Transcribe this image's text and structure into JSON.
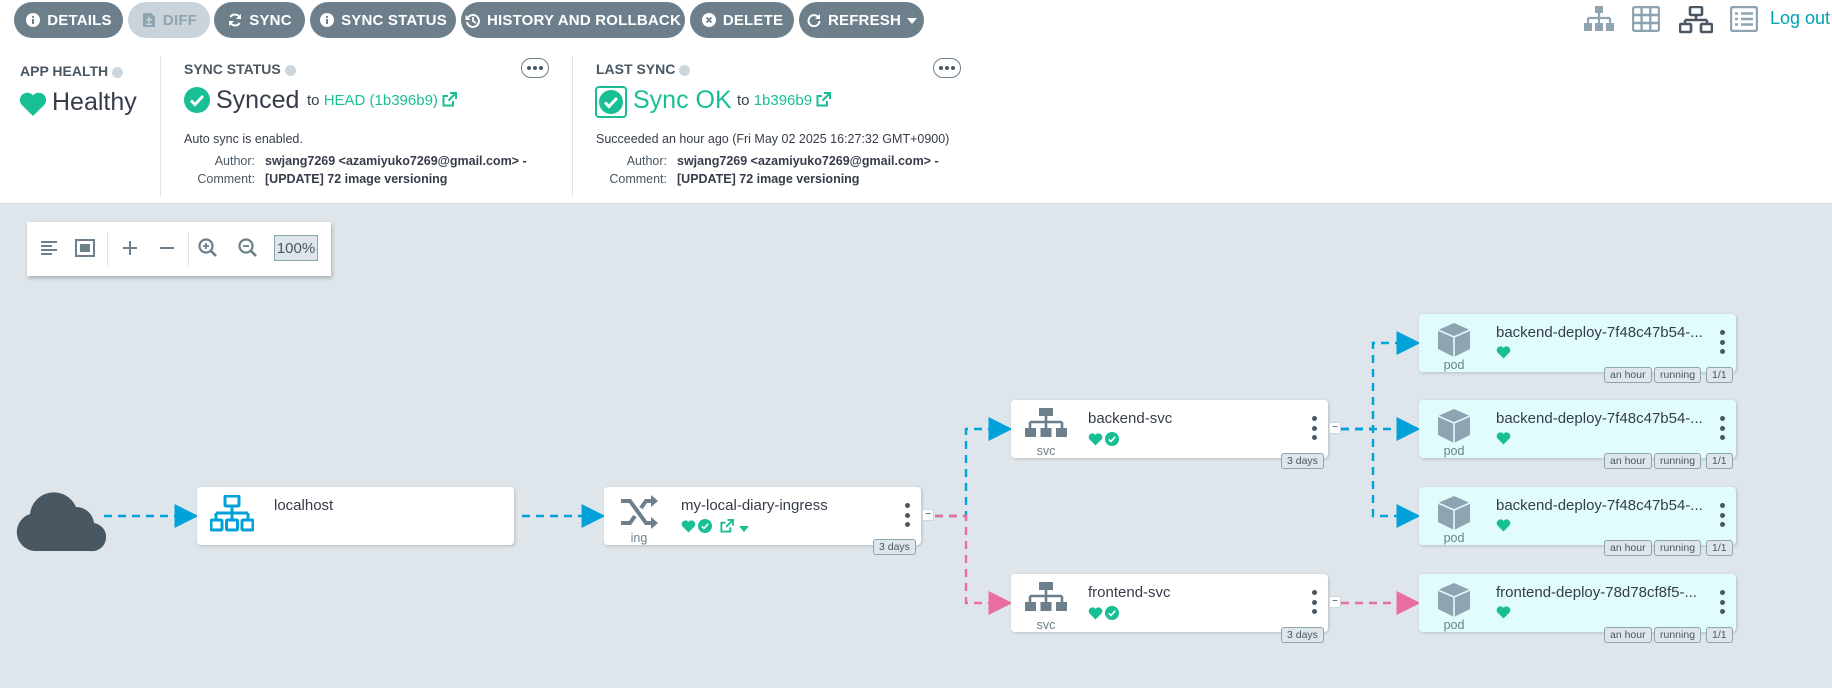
{
  "toolbar": {
    "buttons": [
      {
        "label": "Details",
        "icon": "info-circle-icon",
        "disabled": false
      },
      {
        "label": "Diff",
        "icon": "file-diff-icon",
        "disabled": true
      },
      {
        "label": "Sync",
        "icon": "sync-icon",
        "disabled": false
      },
      {
        "label": "Sync Status",
        "icon": "info-circle-icon",
        "disabled": false
      },
      {
        "label": "History and rollback",
        "icon": "history-icon",
        "disabled": false
      },
      {
        "label": "Delete",
        "icon": "times-circle-icon",
        "disabled": false
      },
      {
        "label": "Refresh",
        "icon": "redo-icon",
        "disabled": false
      }
    ],
    "view_icons": [
      "tree-view-icon",
      "pods-view-icon",
      "network-view-icon",
      "list-view-icon"
    ],
    "logout_label": "Log out"
  },
  "app_health": {
    "title": "APP HEALTH",
    "status": "Healthy",
    "color": "#18be94"
  },
  "sync_status": {
    "title": "SYNC STATUS",
    "status": "Synced",
    "to_label": "to",
    "revision": "HEAD (1b396b9)",
    "auto_sync_text": "Auto sync is enabled.",
    "author_key": "Author:",
    "author_value": "swjang7269 <azamiyuko7269@gmail.com> -",
    "comment_key": "Comment:",
    "comment_value": "[UPDATE] 72 image versioning"
  },
  "last_sync": {
    "title": "LAST SYNC",
    "status": "Sync OK",
    "to_label": "to",
    "revision": "1b396b9",
    "succeeded_text": "Succeeded an hour ago (Fri May 02 2025 16:27:32 GMT+0900)",
    "author_key": "Author:",
    "author_value": "swjang7269 <azamiyuko7269@gmail.com> -",
    "comment_key": "Comment:",
    "comment_value": "[UPDATE] 72 image versioning"
  },
  "zoom": {
    "value": "100%"
  },
  "colors": {
    "accent": "#18be94",
    "ingress_edge": "#00a2d9",
    "frontend_edge": "#e96d9e",
    "toolbar_button": "#6d7f8b",
    "pod_bg": "#e0fcfc"
  },
  "nodes": {
    "cloud": {
      "icon": "cloud-icon"
    },
    "localhost": {
      "name": "localhost",
      "icon": "network-icon"
    },
    "ingress": {
      "name": "my-local-diary-ingress",
      "kind": "ing",
      "age": "3 days",
      "icon": "ingress-icon"
    },
    "backend_svc": {
      "name": "backend-svc",
      "kind": "svc",
      "age": "3 days",
      "icon": "service-icon"
    },
    "frontend_svc": {
      "name": "frontend-svc",
      "kind": "svc",
      "age": "3 days",
      "icon": "service-icon"
    },
    "pods": [
      {
        "name": "backend-deploy-7f48c47b54-...",
        "kind": "pod",
        "age": "an hour",
        "status": "running",
        "ready": "1/1"
      },
      {
        "name": "backend-deploy-7f48c47b54-...",
        "kind": "pod",
        "age": "an hour",
        "status": "running",
        "ready": "1/1"
      },
      {
        "name": "backend-deploy-7f48c47b54-...",
        "kind": "pod",
        "age": "an hour",
        "status": "running",
        "ready": "1/1"
      },
      {
        "name": "frontend-deploy-78d78cf8f5-...",
        "kind": "pod",
        "age": "an hour",
        "status": "running",
        "ready": "1/1"
      }
    ]
  }
}
